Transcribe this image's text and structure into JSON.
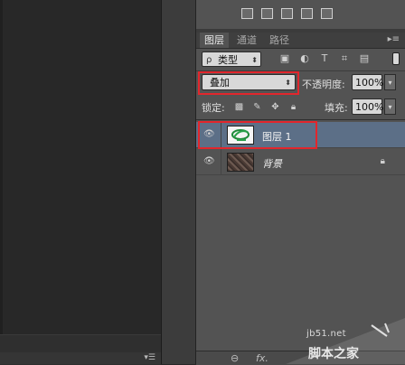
{
  "layers_panel": {
    "tabs": [
      "图层",
      "通道",
      "路径"
    ],
    "filter_kind": "类型",
    "blend_mode": "叠加",
    "opacity_label": "不透明度:",
    "opacity_value": "100%",
    "lock_label": "锁定:",
    "fill_label": "填充:",
    "fill_value": "100%",
    "layers": [
      {
        "name": "图层 1",
        "selected": true,
        "visible": true,
        "locked": false
      },
      {
        "name": "背景",
        "selected": false,
        "visible": true,
        "locked": true
      }
    ]
  },
  "icons": {
    "filter": [
      "image-filter-icon",
      "adjustment-filter-icon",
      "type-filter-icon",
      "shape-filter-icon",
      "smart-object-filter-icon"
    ],
    "lock": [
      "lock-transparent-pixels-icon",
      "lock-image-pixels-icon",
      "lock-position-icon",
      "lock-all-icon"
    ],
    "bottom": [
      "link-layers-icon",
      "layer-style-icon"
    ]
  },
  "highlight_color": "#e2262c",
  "selected_row_color": "#5c6f87",
  "watermark": {
    "site": "jb51.net",
    "name": "脚本之家"
  }
}
